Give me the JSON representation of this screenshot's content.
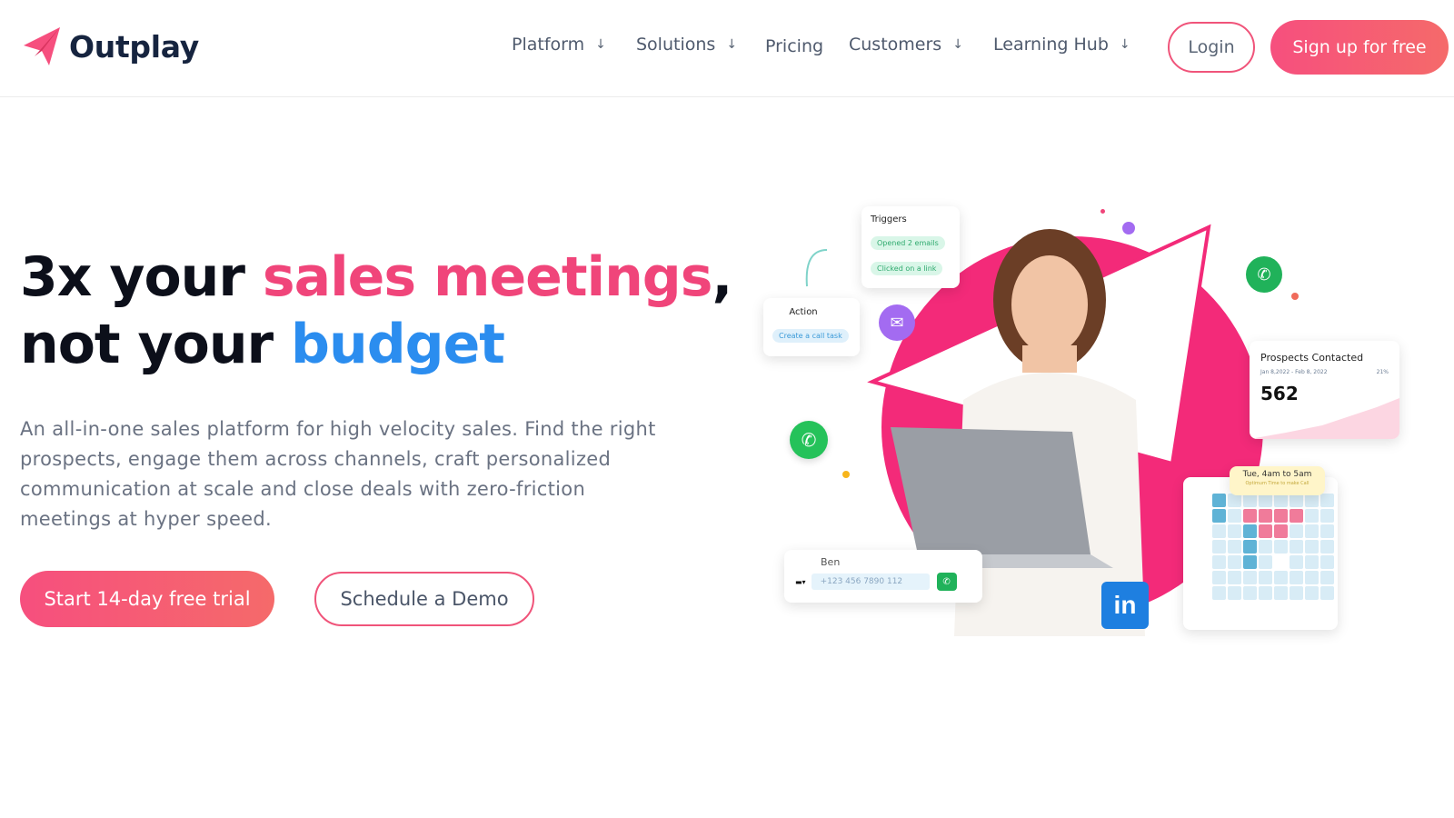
{
  "brand": {
    "name": "Outplay",
    "color": "#f64f7e",
    "dark": "#16243f"
  },
  "nav": {
    "items": [
      {
        "label": "Platform",
        "has_dropdown": true
      },
      {
        "label": "Solutions",
        "has_dropdown": true
      },
      {
        "label": "Pricing",
        "has_dropdown": false
      },
      {
        "label": "Customers",
        "has_dropdown": true
      },
      {
        "label": "Learning Hub",
        "has_dropdown": true
      }
    ],
    "login_label": "Login",
    "signup_label": "Sign up for free"
  },
  "hero": {
    "headline_part1": "3x your ",
    "headline_highlight1": "sales meetings",
    "headline_part2": ",",
    "headline_line2_prefix": "not your ",
    "headline_highlight2": "budget",
    "description": "An all-in-one sales platform for high velocity sales. Find the right prospects, engage them across channels, craft personalized communication at scale and close deals with zero-friction meetings at hyper speed.",
    "cta_primary": "Start 14-day free trial",
    "cta_secondary": "Schedule a Demo"
  },
  "illustration": {
    "triggers_card": {
      "title": "Triggers",
      "chips": [
        "Opened 2 emails",
        "Clicked on a link"
      ]
    },
    "action_card": {
      "title": "Action",
      "chip": "Create a call task"
    },
    "prospects_card": {
      "title": "Prospects Contacted",
      "date_range": "Jan 8,2022 - Feb 8, 2022",
      "change": "21%",
      "value": "562"
    },
    "call_card": {
      "name": "Ben",
      "phone": "+123 456 7890 112"
    },
    "calendar_card": {
      "tooltip": "Tue, 4am to 5am",
      "tooltip_sub": "Optimum Time to make Call"
    },
    "icons": [
      "whatsapp-icon",
      "email-icon",
      "phone-icon",
      "linkedin-icon"
    ]
  },
  "colors": {
    "pink": "#f0457a",
    "blue": "#2b8def",
    "whatsapp": "#25c25a",
    "linkedin": "#1e7fe0",
    "email": "#a36bf1"
  }
}
